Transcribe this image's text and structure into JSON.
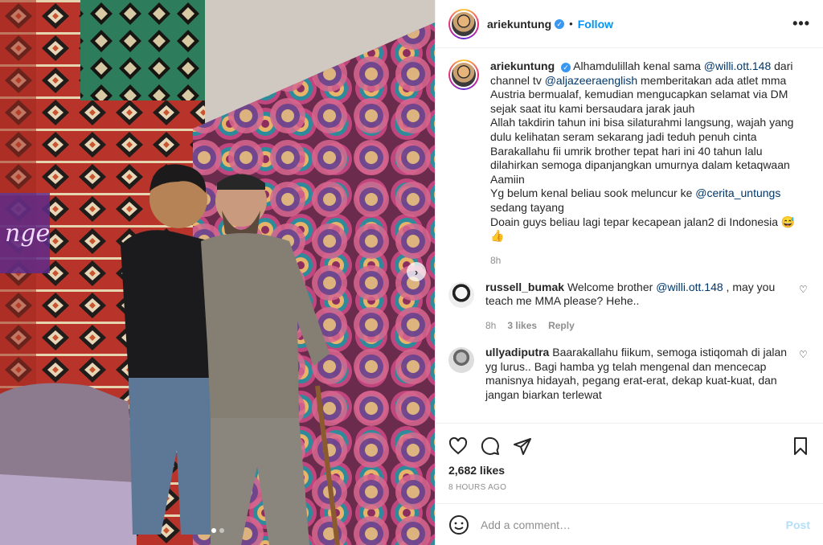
{
  "post": {
    "author": "ariekuntung",
    "follow_label": "Follow",
    "more_label": "•••",
    "verified_mark": "✓",
    "separator": "•"
  },
  "caption": {
    "author": "ariekuntung",
    "parts": {
      "p1_a": "Alhamdulillah kenal sama ",
      "m1": "@willi.ott.148",
      "p1_b": " dari channel tv ",
      "m2": "@aljazeeraenglish",
      "p1_c": " memberitakan ada atlet mma Austria bermualaf, kemudian mengucapkan selamat via DM sejak saat itu kami bersaudara jarak jauh",
      "p2": "Allah takdirin tahun ini bisa silaturahmi langsung, wajah yang dulu kelihatan seram sekarang jadi teduh penuh cinta",
      "p3": "Barakallahu fii umrik brother tepat hari ini 40 tahun lalu dilahirkan semoga dipanjangkan umurnya dalam ketaqwaan Aamiin",
      "p4_a": "Yg belum kenal beliau sook meluncur ke ",
      "m3": "@cerita_untungs",
      "p4_b": " sedang tayang",
      "p5": "Doain guys beliau lagi tepar kecapean jalan2 di Indonesia 😅 👍"
    },
    "time": "8h"
  },
  "comments": [
    {
      "user": "russell_bumak",
      "text_a": "Welcome brother ",
      "mention": "@willi.ott.148",
      "text_b": " , may you teach me MMA please? Hehe..",
      "time": "8h",
      "likes": "3 likes",
      "reply": "Reply"
    },
    {
      "user": "ullyadiputra",
      "text": "Baarakallahu fiikum, semoga istiqomah di jalan yg lurus.. Bagi hamba yg telah mengenal dan mencecap manisnya hidayah, pegang erat-erat, dekap kuat-kuat, dan jangan biarkan terlewat"
    }
  ],
  "actions": {
    "likes": "2,682 likes",
    "timestamp": "8 HOURS AGO"
  },
  "add_comment": {
    "placeholder": "Add a comment…",
    "post_label": "Post"
  },
  "colors": {
    "link": "#0095f6",
    "mention": "#00376b",
    "muted": "#8e8e8e",
    "post_disabled": "#b2dffc"
  },
  "icons": [
    "heart-icon",
    "comment-icon",
    "share-icon",
    "bookmark-icon",
    "emoji-icon",
    "more-icon",
    "verified-icon",
    "chevron-right-icon"
  ]
}
